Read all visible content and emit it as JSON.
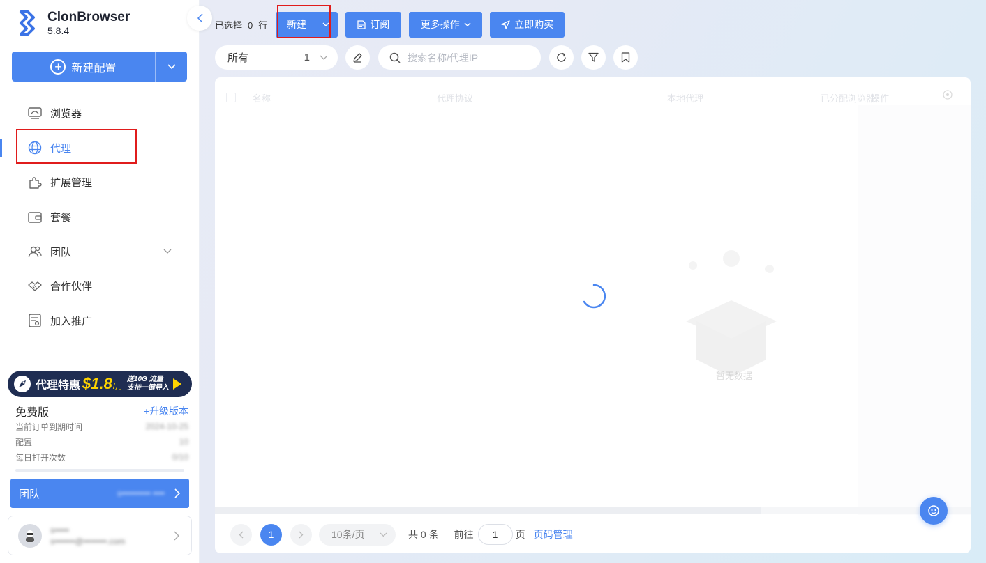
{
  "app": {
    "name": "ClonBrowser",
    "version": "5.8.4"
  },
  "sidebar": {
    "new_config_label": "新建配置",
    "items": [
      {
        "label": "浏览器",
        "icon": "monitor-icon"
      },
      {
        "label": "代理",
        "icon": "globe-icon",
        "active": true
      },
      {
        "label": "扩展管理",
        "icon": "puzzle-icon"
      },
      {
        "label": "套餐",
        "icon": "wallet-icon"
      },
      {
        "label": "团队",
        "icon": "team-icon"
      },
      {
        "label": "合作伙伴",
        "icon": "handshake-icon"
      },
      {
        "label": "加入推广",
        "icon": "promote-icon"
      }
    ],
    "promo": {
      "title": "代理特惠",
      "price": "$1.8",
      "unit": "/月",
      "line1": "送10G 流量",
      "line2": "支持一键导入"
    },
    "plan": {
      "name": "免费版",
      "upgrade": "+升级版本",
      "rows": [
        {
          "label": "当前订单到期时间",
          "value": "2024-10-25"
        },
        {
          "label": "配置",
          "value": "10"
        },
        {
          "label": "每日打开次数",
          "value": "0/10"
        }
      ]
    },
    "team": {
      "label": "团队",
      "value": "s•••••••••• ••••"
    },
    "user": {
      "name": "s•••••",
      "email": "s•••••••@••••••••.com"
    }
  },
  "toolbar": {
    "selected_prefix": "已选择",
    "selected_count": "0",
    "selected_suffix": "行",
    "new_label": "新建",
    "subscribe_label": "订阅",
    "more_label": "更多操作",
    "buy_label": "立即购买"
  },
  "filter": {
    "group_label": "所有",
    "group_count": "1",
    "search_placeholder": "搜索名称/代理IP"
  },
  "table": {
    "columns": [
      "名称",
      "代理协议",
      "本地代理",
      "已分配浏览器",
      "操作"
    ],
    "empty_text": "暂无数据"
  },
  "pagination": {
    "current_page": "1",
    "page_size": "10条/页",
    "total": "共 0 条",
    "goto_prefix": "前往",
    "goto_value": "1",
    "goto_suffix": "页",
    "manage_label": "页码管理"
  },
  "colors": {
    "accent": "#4a86f0",
    "highlight": "#e01c1c",
    "promo_bg": "#1f2d52",
    "promo_price": "#ffd400"
  }
}
